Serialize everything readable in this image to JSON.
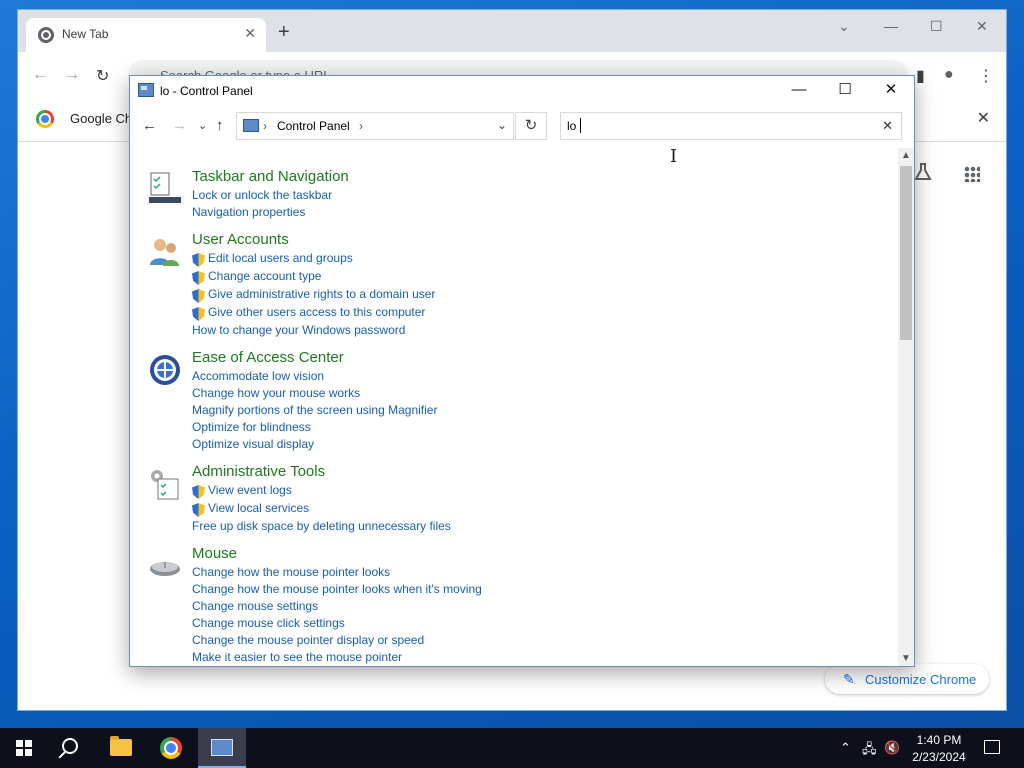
{
  "chrome": {
    "tab_title": "New Tab",
    "tab_close": "✕",
    "new_tab": "+",
    "omnibox_placeholder": "Search Google or type a URL",
    "bookmark_label": "Google Chrome",
    "bookmark_close": "✕",
    "customize_label": "Customize Chrome"
  },
  "control_panel": {
    "title": "lo - Control Panel",
    "breadcrumb": "Control Panel",
    "search_value": "lo",
    "groups": [
      {
        "title": "Taskbar and Navigation",
        "icon": "taskbar-icon",
        "links": [
          {
            "label": "Lock or unlock the taskbar",
            "shield": false
          },
          {
            "label": "Navigation properties",
            "shield": false
          }
        ]
      },
      {
        "title": "User Accounts",
        "icon": "user-accounts-icon",
        "links": [
          {
            "label": "Edit local users and groups",
            "shield": true
          },
          {
            "label": "Change account type",
            "shield": true
          },
          {
            "label": "Give administrative rights to a domain user",
            "shield": true
          },
          {
            "label": "Give other users access to this computer",
            "shield": true
          },
          {
            "label": "How to change your Windows password",
            "shield": false
          }
        ]
      },
      {
        "title": "Ease of Access Center",
        "icon": "ease-of-access-icon",
        "links": [
          {
            "label": "Accommodate low vision",
            "shield": false
          },
          {
            "label": "Change how your mouse works",
            "shield": false
          },
          {
            "label": "Magnify portions of the screen using Magnifier",
            "shield": false
          },
          {
            "label": "Optimize for blindness",
            "shield": false
          },
          {
            "label": "Optimize visual display",
            "shield": false
          }
        ]
      },
      {
        "title": "Administrative Tools",
        "icon": "administrative-tools-icon",
        "links": [
          {
            "label": "View event logs",
            "shield": true
          },
          {
            "label": "View local services",
            "shield": true
          },
          {
            "label": "Free up disk space by deleting unnecessary files",
            "shield": false
          }
        ]
      },
      {
        "title": "Mouse",
        "icon": "mouse-icon",
        "links": [
          {
            "label": "Change how the mouse pointer looks",
            "shield": false
          },
          {
            "label": "Change how the mouse pointer looks when it's moving",
            "shield": false
          },
          {
            "label": "Change mouse settings",
            "shield": false
          },
          {
            "label": "Change mouse click settings",
            "shield": false
          },
          {
            "label": "Change the mouse pointer display or speed",
            "shield": false
          },
          {
            "label": "Make it easier to see the mouse pointer",
            "shield": false
          }
        ]
      }
    ]
  },
  "taskbar": {
    "time": "1:40 PM",
    "date": "2/23/2024"
  },
  "colors": {
    "group_title": "#1e7b1e",
    "link": "#1a5fb4",
    "taskbar": "#0d0f1a"
  }
}
